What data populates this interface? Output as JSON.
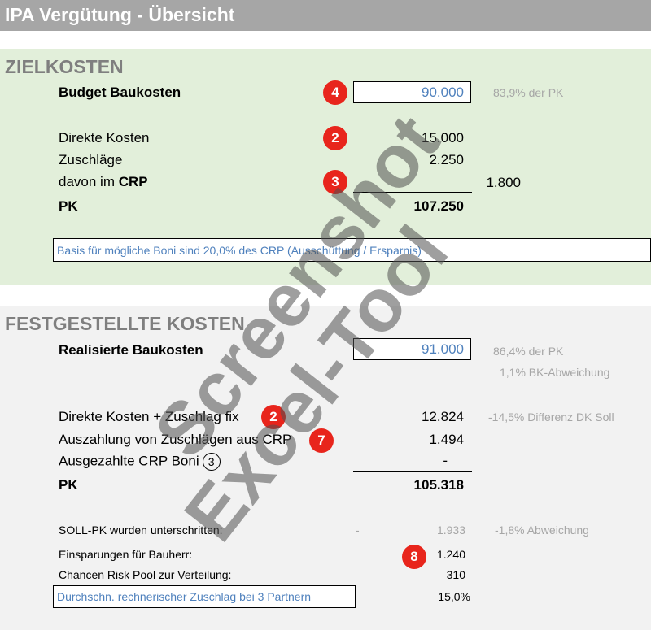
{
  "title": "IPA Vergütung - Übersicht",
  "zielkosten": {
    "heading": "ZIELKOSTEN",
    "budget_label": "Budget Baukosten",
    "budget_value": "90.000",
    "budget_note": "83,9% der PK",
    "direkte_label": "Direkte Kosten",
    "direkte_value": "15.000",
    "zuschlaege_label": "Zuschläge",
    "zuschlaege_value": "2.250",
    "crp_label_prefix": "davon im ",
    "crp_label_bold": "CRP",
    "crp_value": "1.800",
    "pk_label": "PK",
    "pk_value": "107.250",
    "basis_text": "Basis für mögliche Boni sind 20,0% des CRP (Ausschüttung / Ersparnis)",
    "badges": [
      "4",
      "2",
      "3"
    ]
  },
  "festgestellt": {
    "heading": "FESTGESTELLTE KOSTEN",
    "real_label": "Realisierte Baukosten",
    "real_value": "91.000",
    "real_note1": "86,4% der PK",
    "real_note2": "1,1% BK-Abweichung",
    "dk_label": "Direkte Kosten +  Zuschlag fix",
    "dk_value": "12.824",
    "dk_note": "-14,5% Differenz DK Soll",
    "ausz_label": "Auszahlung von Zuschlägen aus CRP",
    "ausz_value": "1.494",
    "boni_label": "Ausgezahlte CRP Boni",
    "boni_circle": "3",
    "boni_value": "-",
    "pk_label": "PK",
    "pk_value": "105.318",
    "soll_label": "SOLL-PK wurden unterschritten:",
    "soll_dash": "-",
    "soll_value": "1.933",
    "soll_note": "-1,8% Abweichung",
    "einsp_label": "Einsparungen für Bauherr:",
    "einsp_value": "1.240",
    "chancen_label": "Chancen Risk Pool zur Verteilung:",
    "chancen_value": "310",
    "durch_label": "Durchschn. rechnerischer Zuschlag bei 3 Partnern",
    "durch_value": "15,0%",
    "badges": [
      "2",
      "7",
      "8"
    ]
  },
  "watermark": {
    "line1": "Screenshot",
    "line2": "Excel-Tool"
  }
}
